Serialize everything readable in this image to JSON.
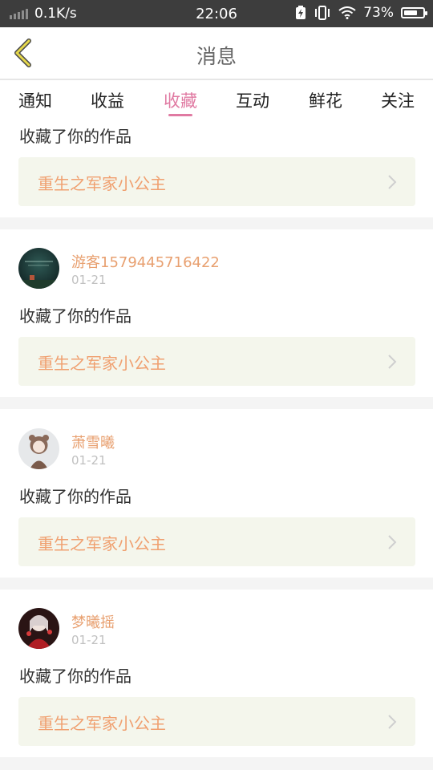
{
  "status_bar": {
    "network_speed": "0.1K/s",
    "time": "22:06",
    "battery_percent": "73%",
    "battery_level": 0.73,
    "icons": [
      "signal-icon",
      "battery-saver-icon",
      "vibrate-icon",
      "wifi-icon",
      "battery-icon"
    ]
  },
  "header": {
    "title": "消息",
    "back_icon": "chevron-left-icon"
  },
  "tabs": [
    {
      "label": "通知"
    },
    {
      "label": "收益"
    },
    {
      "label": "收藏",
      "active": true
    },
    {
      "label": "互动"
    },
    {
      "label": "鲜花"
    },
    {
      "label": "关注"
    }
  ],
  "colors": {
    "accent": "#e07aa2",
    "username": "#e8a070",
    "work_title": "#f0a070",
    "work_bg": "#f4f6ec"
  },
  "feed": [
    {
      "message": "收藏了你的作品",
      "work_title": "重生之军家小公主"
    },
    {
      "username": "游客1579445716422",
      "date": "01-21",
      "message": "收藏了你的作品",
      "work_title": "重生之军家小公主"
    },
    {
      "username": "萧雪曦",
      "date": "01-21",
      "message": "收藏了你的作品",
      "work_title": "重生之军家小公主"
    },
    {
      "username": "梦曦摇",
      "date": "01-21",
      "message": "收藏了你的作品",
      "work_title": "重生之军家小公主"
    }
  ]
}
